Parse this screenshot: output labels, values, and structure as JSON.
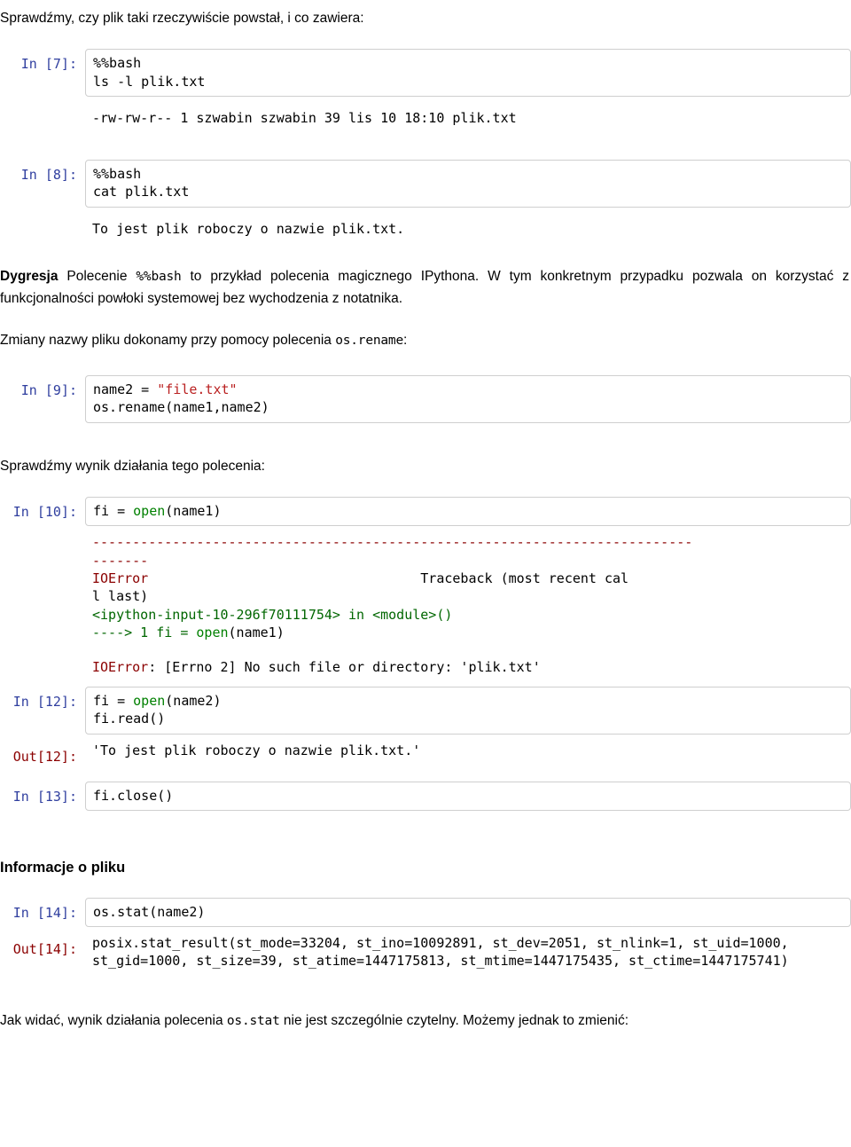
{
  "document": {
    "language": "pl",
    "colors": {
      "in_prompt": "#303F9F",
      "out_prompt": "#8B0000",
      "string_literal": "#BA2121",
      "builtin": "#008000",
      "traceback_error": "#8B0000",
      "traceback_file": "#006600",
      "cell_border": "#cfcfcf",
      "background": "#ffffff"
    }
  },
  "intro": {
    "text": "Sprawdźmy, czy plik taki rzeczywiście powstał, i co zawiera:"
  },
  "cell7": {
    "prompt": "In [7]:",
    "code_line1": "%%bash",
    "code_line2": "ls -l plik.txt",
    "output": "-rw-rw-r-- 1 szwabin szwabin 39 lis 10 18:10 plik.txt"
  },
  "cell8": {
    "prompt": "In [8]:",
    "code_line1": "%%bash",
    "code_line2": "cat plik.txt",
    "output": "To jest plik roboczy o nazwie plik.txt."
  },
  "dygresja": {
    "bold_lead": "Dygresja",
    "part1": " Polecenie ",
    "mono": "%%bash",
    "part2": " to przykład polecenia magicznego IPythona. W tym konkretnym przypadku pozwala on korzystać z funkcjonalności powłoki systemowej bez wychodzenia z notatnika."
  },
  "para_rename": {
    "part1": "Zmiany nazwy pliku dokonamy przy pomocy polecenia ",
    "mono": "os.rename",
    "part2": ":"
  },
  "cell9": {
    "prompt": "In [9]:",
    "line1_pre": "name2 = ",
    "line1_str": "\"file.txt\"",
    "line2": "os.rename(name1,name2)"
  },
  "para_check": {
    "text": "Sprawdźmy wynik działania tego polecenia:"
  },
  "cell10": {
    "prompt": "In [10]:",
    "code_pre": "fi = ",
    "code_builtin": "open",
    "code_post": "(name1)",
    "traceback": {
      "rule_line1": "---------------------------------------------------------------------------",
      "rule_line2": "-------",
      "error_name": "IOError",
      "error_header_spacer": "                                  ",
      "error_header_text": "Traceback (most recent cal",
      "error_header_wrap": "l last)",
      "file_line": "<ipython-input-10-296f70111754> in <module>()",
      "arrow_line_pre": "----> 1 fi = ",
      "arrow_line_builtin": "open",
      "arrow_line_post": "(name1)",
      "final_error_label": "IOError",
      "final_error_msg": ": [Errno 2] No such file or directory: 'plik.txt'"
    }
  },
  "cell12": {
    "prompt": "In [12]:",
    "line1_pre": "fi = ",
    "line1_builtin": "open",
    "line1_post": "(name2)",
    "line2": "fi.read()",
    "out_prompt": "Out[12]:",
    "out_value": "'To jest plik roboczy o nazwie plik.txt.'"
  },
  "cell13": {
    "prompt": "In [13]:",
    "code": "fi.close()"
  },
  "section_info": {
    "heading": "Informacje o pliku"
  },
  "cell14": {
    "prompt": "In [14]:",
    "code": "os.stat(name2)",
    "out_prompt": "Out[14]:",
    "out_value": "posix.stat_result(st_mode=33204, st_ino=10092891, st_dev=2051, st_nlink=1, st_uid=1000, st_gid=1000, st_size=39, st_atime=1447175813, st_mtime=1447175435, st_ctime=1447175741)"
  },
  "para_closing": {
    "part1": "Jak widać, wynik działania polecenia ",
    "mono": "os.stat",
    "part2": " nie jest szczególnie czytelny. Możemy jednak to zmienić:"
  }
}
